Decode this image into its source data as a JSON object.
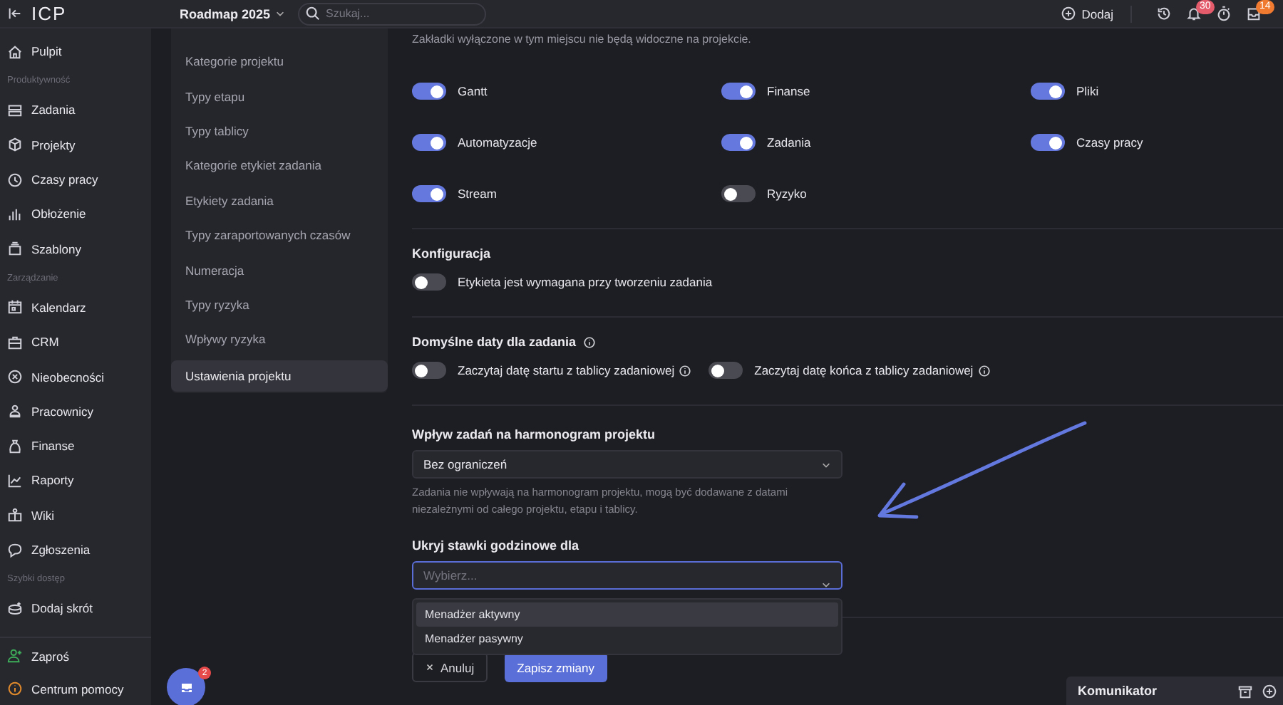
{
  "topbar": {
    "logo": "ICP",
    "project": "Roadmap 2025",
    "search": {
      "placeholder": "Szukaj..."
    },
    "add_label": "Dodaj",
    "notifications_badge": "30",
    "inbox_badge": "14"
  },
  "sidebar": {
    "sections": [
      {
        "items": [
          {
            "label": "Pulpit"
          }
        ]
      },
      {
        "heading": "Produktywność",
        "items": [
          {
            "label": "Zadania"
          },
          {
            "label": "Projekty"
          },
          {
            "label": "Czasy pracy"
          },
          {
            "label": "Obłożenie"
          },
          {
            "label": "Szablony"
          }
        ]
      },
      {
        "heading": "Zarządzanie",
        "items": [
          {
            "label": "Kalendarz"
          },
          {
            "label": "CRM"
          },
          {
            "label": "Nieobecności"
          },
          {
            "label": "Pracownicy"
          },
          {
            "label": "Finanse"
          },
          {
            "label": "Raporty"
          },
          {
            "label": "Wiki"
          },
          {
            "label": "Zgłoszenia"
          }
        ]
      },
      {
        "heading": "Szybki dostęp",
        "items": [
          {
            "label": "Dodaj skrót"
          }
        ]
      }
    ],
    "footer": [
      {
        "label": "Zaproś",
        "color": "#3fae5a"
      },
      {
        "label": "Centrum pomocy",
        "color": "#e08a2c"
      }
    ]
  },
  "settings_nav": [
    {
      "label": "Kategorie projektu",
      "selected": false
    },
    {
      "label": "Typy etapu",
      "selected": false
    },
    {
      "label": "Typy tablicy",
      "selected": false
    },
    {
      "label": "Kategorie etykiet zadania",
      "selected": false
    },
    {
      "label": "Etykiety zadania",
      "selected": false
    },
    {
      "label": "Typy zaraportowanych czasów",
      "selected": false
    },
    {
      "label": "Numeracja",
      "selected": false
    },
    {
      "label": "Typy ryzyka",
      "selected": false
    },
    {
      "label": "Wpływy ryzyka",
      "selected": false
    },
    {
      "label": "Ustawienia projektu",
      "selected": true
    }
  ],
  "tabs_section": {
    "description": "Zakładki wyłączone w tym miejscu nie będą widoczne na projekcie.",
    "toggles": [
      {
        "label": "Gantt",
        "on": true
      },
      {
        "label": "Finanse",
        "on": true
      },
      {
        "label": "Pliki",
        "on": true
      },
      {
        "label": "Automatyzacje",
        "on": true
      },
      {
        "label": "Zadania",
        "on": true
      },
      {
        "label": "Czasy pracy",
        "on": true
      },
      {
        "label": "Stream",
        "on": true
      },
      {
        "label": "Ryzyko",
        "on": false
      }
    ]
  },
  "configuration": {
    "title": "Konfiguracja",
    "toggles": [
      {
        "label": "Etykieta jest wymagana przy tworzeniu zadania",
        "on": false
      }
    ]
  },
  "default_dates": {
    "title": "Domyślne daty dla zadania",
    "toggles": [
      {
        "label": "Zaczytaj datę startu z tablicy zadaniowej",
        "on": false
      },
      {
        "label": "Zaczytaj datę końca z tablicy zadaniowej",
        "on": false
      }
    ]
  },
  "schedule_impact": {
    "title": "Wpływ zadań na harmonogram projektu",
    "select": {
      "value": "Bez ograniczeń"
    },
    "hint": "Zadania nie wpływają na harmonogram projektu, mogą być dodawane z datami niezależnymi od całego projektu, etapu i tablicy."
  },
  "hide_rates": {
    "title": "Ukryj stawki godzinowe dla",
    "select": {
      "placeholder": "Wybierz...",
      "focused": true
    },
    "options": [
      {
        "label": "Menadżer aktywny",
        "highlighted": true
      },
      {
        "label": "Menadżer pasywny",
        "highlighted": false
      }
    ]
  },
  "buttons": [
    {
      "label": "Anuluj",
      "kind": "secondary"
    },
    {
      "label": "Zapisz zmiany",
      "kind": "primary"
    }
  ],
  "chat": {
    "badge": "2"
  },
  "messenger": {
    "title": "Komunikator"
  }
}
